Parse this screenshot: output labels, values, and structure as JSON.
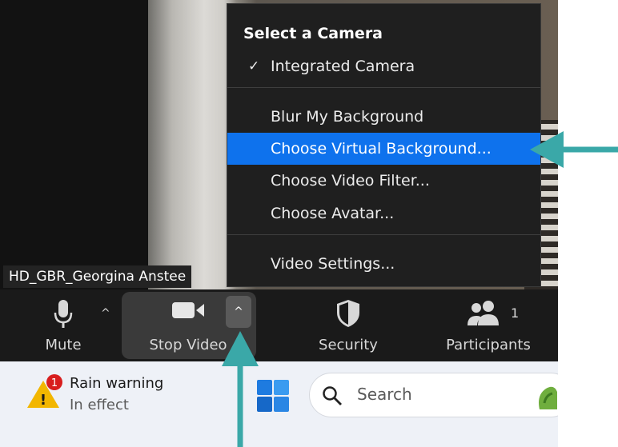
{
  "video": {
    "participant_name": "HD_GBR_Georgina Anstee"
  },
  "camera_menu": {
    "heading": "Select a Camera",
    "camera_item": {
      "check": "✓",
      "label": "Integrated Camera"
    },
    "items": [
      {
        "label": "Blur My Background"
      },
      {
        "label": "Choose Virtual Background..."
      },
      {
        "label": "Choose Video Filter..."
      },
      {
        "label": "Choose Avatar..."
      }
    ],
    "settings_label": "Video Settings...",
    "selected_color": "#0e72ed"
  },
  "toolbar": {
    "mute_label": "Mute",
    "stop_video_label": "Stop Video",
    "security_label": "Security",
    "participants_label": "Participants",
    "participants_count": "1",
    "chevron": "^"
  },
  "taskbar": {
    "weather_badge": "1",
    "weather_title": "Rain warning",
    "weather_subtitle": "In effect",
    "search_placeholder": "Search"
  },
  "annotation": {
    "arrow_color": "#3aa8a8"
  }
}
